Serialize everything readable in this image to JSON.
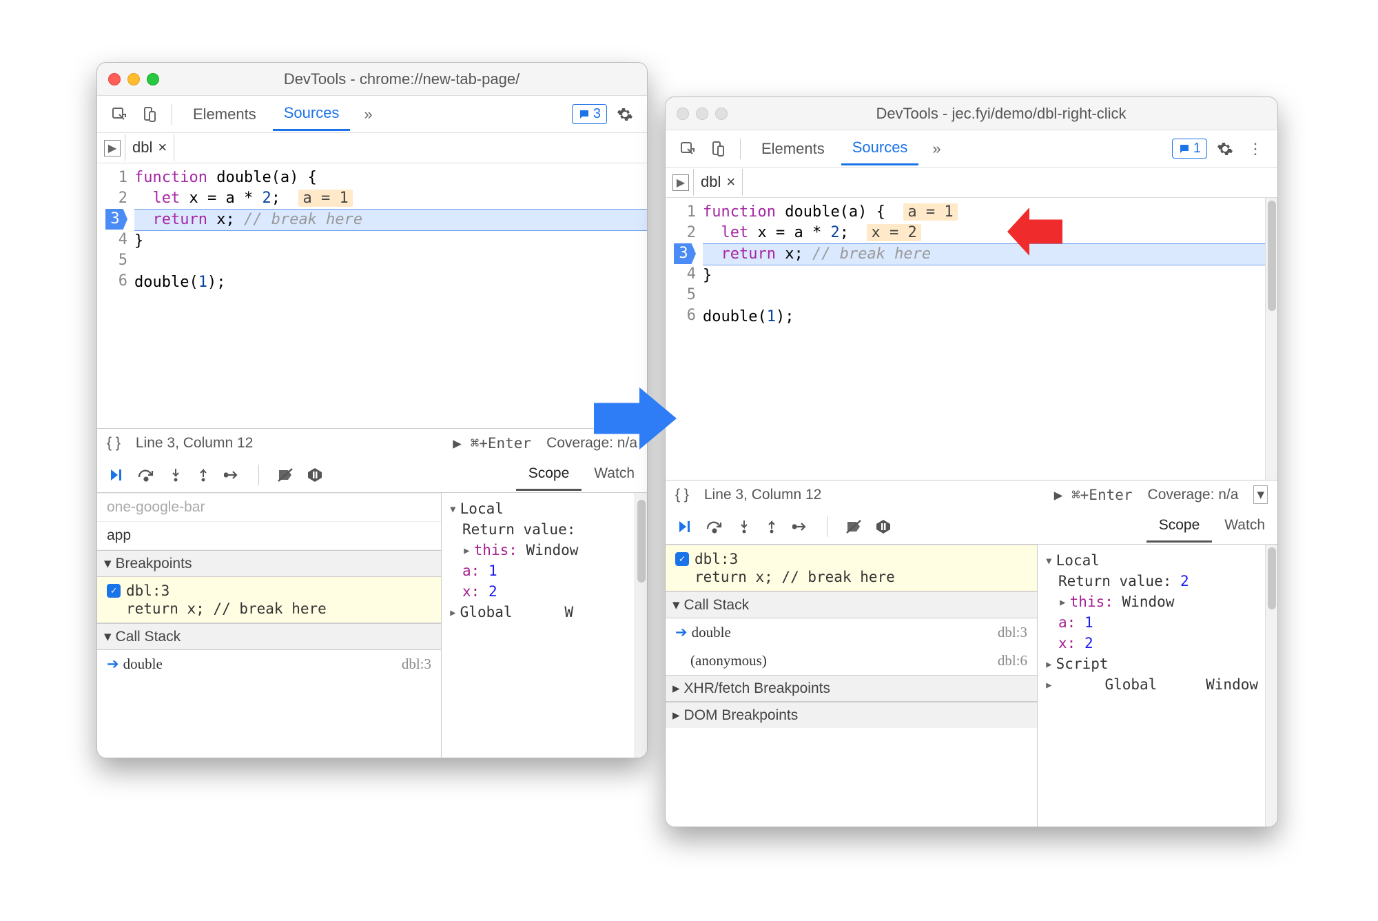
{
  "windows": {
    "left": {
      "title": "DevTools - chrome://new-tab-page/",
      "tabs": {
        "elements": "Elements",
        "sources": "Sources"
      },
      "badge": "3",
      "file_tab": "dbl",
      "code": {
        "lines": [
          "1",
          "2",
          "3",
          "4",
          "5",
          "6"
        ],
        "l1_kw": "function",
        "l1_rest": " double(a) {",
        "l2_kw": "let",
        "l2_mid": " x = a * ",
        "l2_num": "2",
        "l2_sc": ";",
        "l2_hint": "a = 1",
        "l3_kw": "return",
        "l3_mid": " x; ",
        "l3_com": "// break here",
        "l4": "}",
        "l6a": "double(",
        "l6n": "1",
        "l6b": ");"
      },
      "status": {
        "cursor": "Line 3, Column 12",
        "run": "▶ ⌘+Enter",
        "cov": "Coverage: n/a"
      },
      "scope_tabs": {
        "scope": "Scope",
        "watch": "Watch"
      },
      "left_panel": {
        "row_app": "app",
        "breakpoints": "Breakpoints",
        "bp_label": "dbl:3",
        "bp_code": "return x; // break here",
        "callstack": "Call Stack",
        "frame_fn": "double",
        "frame_loc": "dbl:3"
      },
      "scope": {
        "local": "Local",
        "retval": "Return value:",
        "this_label": "this:",
        "this_val": "Window",
        "a_label": "a:",
        "a_val": "1",
        "x_label": "x:",
        "x_val": "2",
        "global": "Global",
        "global_val": "W"
      }
    },
    "right": {
      "title": "DevTools - jec.fyi/demo/dbl-right-click",
      "tabs": {
        "elements": "Elements",
        "sources": "Sources"
      },
      "badge": "1",
      "file_tab": "dbl",
      "code": {
        "lines": [
          "1",
          "2",
          "3",
          "4",
          "5",
          "6"
        ],
        "l1_kw": "function",
        "l1_rest": " double(a) {",
        "l1_hint": "a = 1",
        "l2_kw": "let",
        "l2_mid": " x = a * ",
        "l2_num": "2",
        "l2_sc": ";",
        "l2_hint": "x = 2",
        "l3_kw": "return",
        "l3_mid": " x; ",
        "l3_com": "// break here",
        "l4": "}",
        "l6a": "double(",
        "l6n": "1",
        "l6b": ");"
      },
      "status": {
        "cursor": "Line 3, Column 12",
        "run": "▶ ⌘+Enter",
        "cov": "Coverage: n/a"
      },
      "scope_tabs": {
        "scope": "Scope",
        "watch": "Watch"
      },
      "left_panel": {
        "bp_label": "dbl:3",
        "bp_code": "return x; // break here",
        "callstack": "Call Stack",
        "frame_double": "double",
        "frame_double_loc": "dbl:3",
        "frame_anon": "(anonymous)",
        "frame_anon_loc": "dbl:6",
        "xhr": "XHR/fetch Breakpoints",
        "dom": "DOM Breakpoints"
      },
      "scope": {
        "local": "Local",
        "retval_label": "Return value:",
        "retval_val": "2",
        "this_label": "this:",
        "this_val": "Window",
        "a_label": "a:",
        "a_val": "1",
        "x_label": "x:",
        "x_val": "2",
        "script": "Script",
        "global": "Global",
        "global_val": "Window"
      }
    }
  }
}
